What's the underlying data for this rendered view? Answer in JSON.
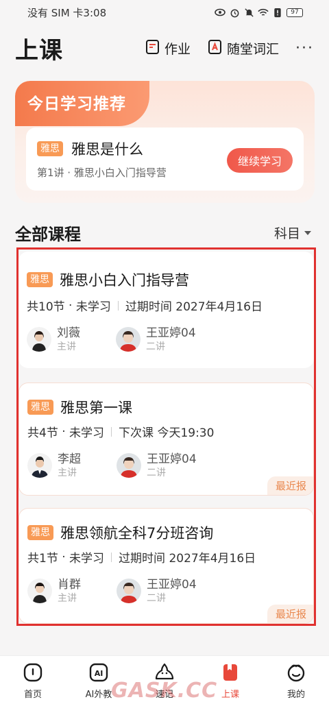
{
  "status_bar": {
    "carrier_time": "没有 SIM 卡3:08",
    "battery": "97"
  },
  "header": {
    "title": "上课",
    "actions": [
      {
        "label": "作业",
        "icon": "homework-icon"
      },
      {
        "label": "随堂词汇",
        "icon": "vocabulary-icon"
      }
    ],
    "more": "···"
  },
  "recommend": {
    "title": "今日学习推荐",
    "tag": "雅思",
    "course": "雅思是什么",
    "subtitle": "第1讲 · 雅思小白入门指导营",
    "button": "继续学习"
  },
  "section": {
    "title": "全部课程",
    "filter": "科目"
  },
  "courses": [
    {
      "tag": "雅思",
      "title": "雅思小白入门指导营",
      "lessons": "共10节",
      "status": "未学习",
      "info": "过期时间 2027年4月16日",
      "teachers": [
        {
          "name": "刘薇",
          "role": "主讲"
        },
        {
          "name": "王亚婷04",
          "role": "二讲"
        }
      ],
      "badge": ""
    },
    {
      "tag": "雅思",
      "title": "雅思第一课",
      "lessons": "共4节",
      "status": "未学习",
      "info": "下次课 今天19:30",
      "teachers": [
        {
          "name": "李超",
          "role": "主讲"
        },
        {
          "name": "王亚婷04",
          "role": "二讲"
        }
      ],
      "badge": "最近报"
    },
    {
      "tag": "雅思",
      "title": "雅思领航全科7分班咨询",
      "lessons": "共1节",
      "status": "未学习",
      "info": "过期时间 2027年4月16日",
      "teachers": [
        {
          "name": "肖群",
          "role": "主讲"
        },
        {
          "name": "王亚婷04",
          "role": "二讲"
        }
      ],
      "badge": "最近报"
    }
  ],
  "bottom_nav": [
    {
      "label": "首页",
      "icon": "home-icon"
    },
    {
      "label": "AI外教",
      "icon": "ai-tutor-icon"
    },
    {
      "label": "速记",
      "icon": "notes-icon"
    },
    {
      "label": "上课",
      "icon": "class-icon",
      "active": true
    },
    {
      "label": "我的",
      "icon": "profile-icon"
    }
  ],
  "watermark": "GASK.CC",
  "colors": {
    "accent": "#e8483a",
    "tag": "#f89a55",
    "badge_text": "#e9884f"
  }
}
